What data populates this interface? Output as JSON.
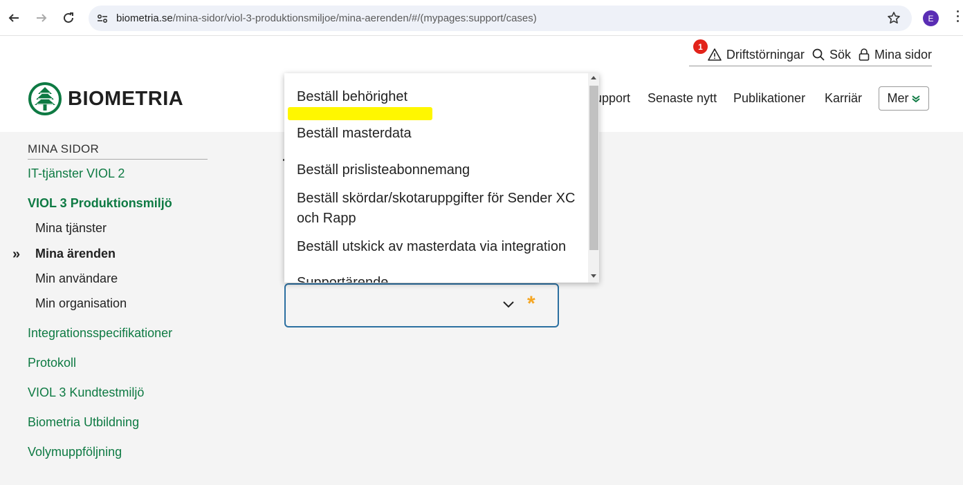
{
  "browser": {
    "url_host": "biometria.se",
    "url_path": "/mina-sidor/viol-3-produktionsmiljoe/mina-aerenden/#/(mypages:support/cases)",
    "profile_initial": "E"
  },
  "header": {
    "alert_count": "1",
    "top_links": [
      "Driftstörningar",
      "Sök",
      "Mina sidor"
    ],
    "logo_text": "BIOMETRIA",
    "nav": [
      "upport",
      "Senaste nytt",
      "Publikationer",
      "Karriär"
    ],
    "more_label": "Mer"
  },
  "sidebar": {
    "title": "MINA SIDOR",
    "items": [
      "IT-tjänster VIOL 2",
      "VIOL 3 Produktionsmiljö",
      "Mina tjänster",
      "Mina ärenden",
      "Min användare",
      "Min organisation",
      "Integrationsspecifikationer",
      "Protokoll",
      "VIOL 3 Kundtestmiljö",
      "Biometria Utbildning",
      "Volymuppföljning"
    ],
    "active_marker": "»"
  },
  "form": {
    "required_marker": "*"
  },
  "dropdown": {
    "options": [
      "Beställ behörighet",
      "Beställ masterdata",
      "Beställ prislisteabonnemang",
      "Beställ skördar/skotaruppgifter för Sender XC och Rapp",
      "Beställ utskick av masterdata via integration",
      "Supportärende"
    ]
  },
  "colors": {
    "brand_green": "#0e7a43",
    "highlight_yellow": "#fff700",
    "select_border": "#2a6fa0",
    "required_orange": "#f5a623",
    "alert_red": "#e2231a"
  }
}
